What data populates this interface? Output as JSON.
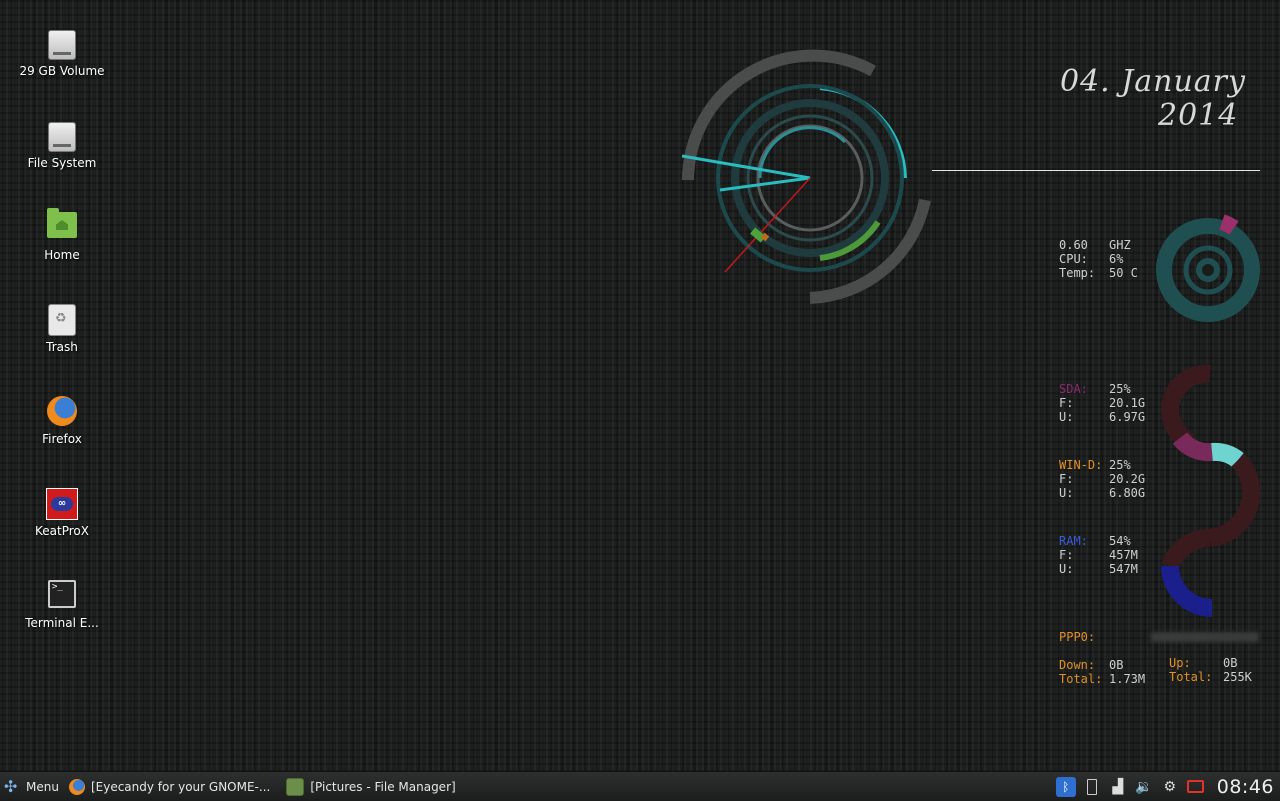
{
  "desktop": {
    "icons": [
      {
        "label": "29 GB Volume",
        "icon": "drive-icon"
      },
      {
        "label": "File System",
        "icon": "drive-icon"
      },
      {
        "label": "Home",
        "icon": "home-folder-icon"
      },
      {
        "label": "Trash",
        "icon": "trash-icon"
      },
      {
        "label": "Firefox",
        "icon": "firefox-icon"
      },
      {
        "label": "KeatProX",
        "icon": "keatprox-icon"
      },
      {
        "label": "Terminal E...",
        "icon": "terminal-icon"
      }
    ]
  },
  "conky": {
    "date": {
      "day_month": "04. January",
      "year": "2014"
    },
    "cpu": {
      "freq_value": "0.60",
      "freq_unit": "GHZ",
      "cpu_label": "CPU:",
      "cpu_value": "6%",
      "temp_label": "Temp:",
      "temp_value": "50 C",
      "cpu_usage_fraction": 0.06
    },
    "sda": {
      "label": "SDA:",
      "percent": "25%",
      "free_label": "F:",
      "free": "20.1G",
      "used_label": "U:",
      "used": "6.97G",
      "color": "#8a2b6e",
      "fraction": 0.25
    },
    "wind": {
      "label": "WIN-D:",
      "percent": "25%",
      "free_label": "F:",
      "free": "20.2G",
      "used_label": "U:",
      "used": "6.80G",
      "color": "#e0902a",
      "fraction": 0.25
    },
    "ram": {
      "label": "RAM:",
      "percent": "54%",
      "free_label": "F:",
      "free": "457M",
      "used_label": "U:",
      "used": "547M",
      "color": "#3a5bd8",
      "fraction": 0.54
    },
    "net": {
      "iface_label": "PPP0:",
      "down_label": "Down:",
      "down": "0B",
      "down_total_label": "Total:",
      "down_total": "1.73M",
      "up_label": "Up:",
      "up": "0B",
      "up_total_label": "Total:",
      "up_total": "255K",
      "label_color": "#e0902a"
    },
    "accent_teal": "#2bbcc0",
    "accent_green": "#4d9a3b"
  },
  "taskbar": {
    "menu_label": "Menu",
    "tasks": [
      {
        "label": "[Eyecandy for your GNOME-...",
        "icon": "firefox-icon"
      },
      {
        "label": "[Pictures - File Manager]",
        "icon": "file-manager-icon"
      }
    ],
    "tray_icons": [
      "bluetooth-icon",
      "battery-icon",
      "network-signal-icon",
      "volume-icon",
      "settings-icon",
      "recording-icon"
    ],
    "clock": "08:46"
  }
}
